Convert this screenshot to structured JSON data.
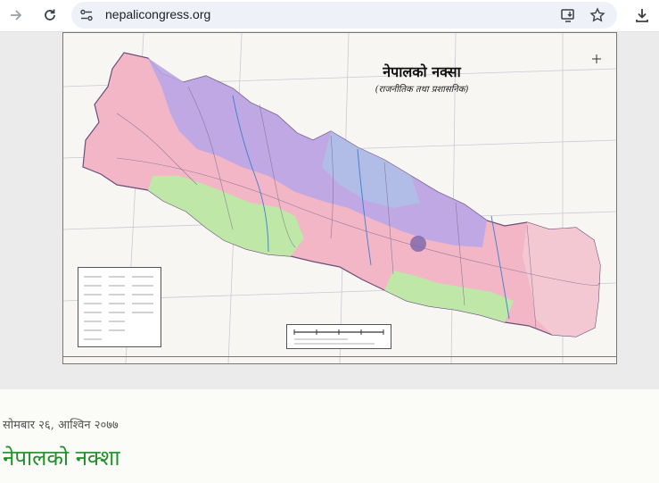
{
  "browser": {
    "url": "nepalicongress.org",
    "icons": {
      "forward": "arrow-right-icon",
      "reload": "reload-icon",
      "site_info": "tune-icon",
      "install": "install-app-icon",
      "bookmark": "star-icon",
      "download": "download-icon"
    }
  },
  "map": {
    "title": "नेपालको नक्सा",
    "subtitle": "(राजनीतिक तथा प्रशासनिक)"
  },
  "post": {
    "date": "सोमबार २६, आश्विन २०७७",
    "title": "नेपालको नक्शा"
  },
  "colors": {
    "accent_title": "#1f8f2a",
    "zone_violet": "#b9a6e6",
    "zone_pink": "#f2b6c6",
    "zone_green": "#bfe7a8",
    "zone_blue": "#aebfe8"
  }
}
